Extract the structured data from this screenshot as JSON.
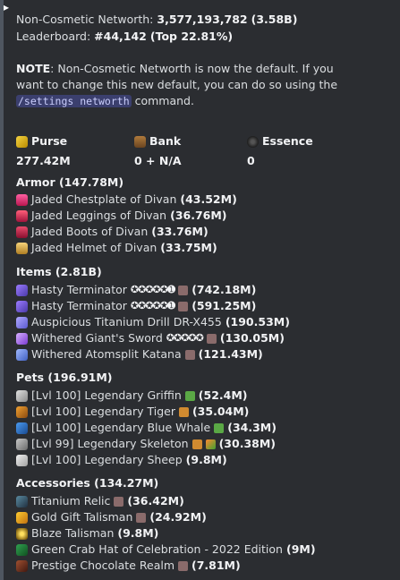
{
  "header": {
    "networth_label": "Non-Cosmetic Networth:",
    "networth_value": "3,577,193,782",
    "networth_short": "(3.58B)",
    "leaderboard_label": "Leaderboard:",
    "leaderboard_value": "#44,142",
    "leaderboard_top": "(Top 22.81%)"
  },
  "note": {
    "label": "NOTE",
    "text1": ": Non-Cosmetic Networth is now the default. If you want to change this new default, you can do so using the ",
    "code": "/settings networth",
    "text2": " command."
  },
  "fields": {
    "purse": {
      "label": "Purse",
      "value": "277.42M"
    },
    "bank": {
      "label": "Bank",
      "value": "0 + N/A"
    },
    "essence": {
      "label": "Essence",
      "value": "0"
    }
  },
  "sections": [
    {
      "title": "Armor (147.78M)",
      "items": [
        {
          "name": "Jaded Chestplate of Divan",
          "value": "(43.52M)"
        },
        {
          "name": "Jaded Leggings of Divan",
          "value": "(36.76M)"
        },
        {
          "name": "Jaded Boots of Divan",
          "value": "(33.76M)"
        },
        {
          "name": "Jaded Helmet of Divan",
          "value": "(33.75M)"
        }
      ]
    },
    {
      "title": "Items (2.81B)",
      "items": [
        {
          "name": "Hasty Terminator",
          "stars": "✪✪✪✪✪➊",
          "value": "(742.18M)"
        },
        {
          "name": "Hasty Terminator",
          "stars": "✪✪✪✪✪➊",
          "value": "(591.25M)"
        },
        {
          "name": "Auspicious Titanium Drill DR-X455",
          "value": "(190.53M)"
        },
        {
          "name": "Withered Giant's Sword",
          "stars": "✪✪✪✪✪",
          "value": "(130.05M)"
        },
        {
          "name": "Withered Atomsplit Katana",
          "value": "(121.43M)"
        }
      ]
    },
    {
      "title": "Pets (196.91M)",
      "items": [
        {
          "name": "[Lvl 100] Legendary Griffin",
          "value": "(52.4M)"
        },
        {
          "name": "[Lvl 100] Legendary Tiger",
          "value": "(35.04M)"
        },
        {
          "name": "[Lvl 100] Legendary Blue Whale",
          "value": "(34.3M)"
        },
        {
          "name": "[Lvl 99] Legendary Skeleton",
          "value": "(30.38M)"
        },
        {
          "name": "[Lvl 100] Legendary Sheep",
          "value": "(9.8M)"
        }
      ]
    },
    {
      "title": "Accessories (134.27M)",
      "items": [
        {
          "name": "Titanium Relic",
          "value": "(36.42M)"
        },
        {
          "name": "Gold Gift Talisman",
          "value": "(24.92M)"
        },
        {
          "name": "Blaze Talisman",
          "value": "(9.8M)"
        },
        {
          "name": "Green Crab Hat of Celebration - 2022 Edition",
          "value": "(9M)"
        },
        {
          "name": "Prestige Chocolate Realm",
          "value": "(7.81M)"
        }
      ]
    }
  ],
  "icons": {
    "purse": "gold-coins-icon",
    "bank": "chest-icon",
    "essence": "essence-orb-icon"
  }
}
